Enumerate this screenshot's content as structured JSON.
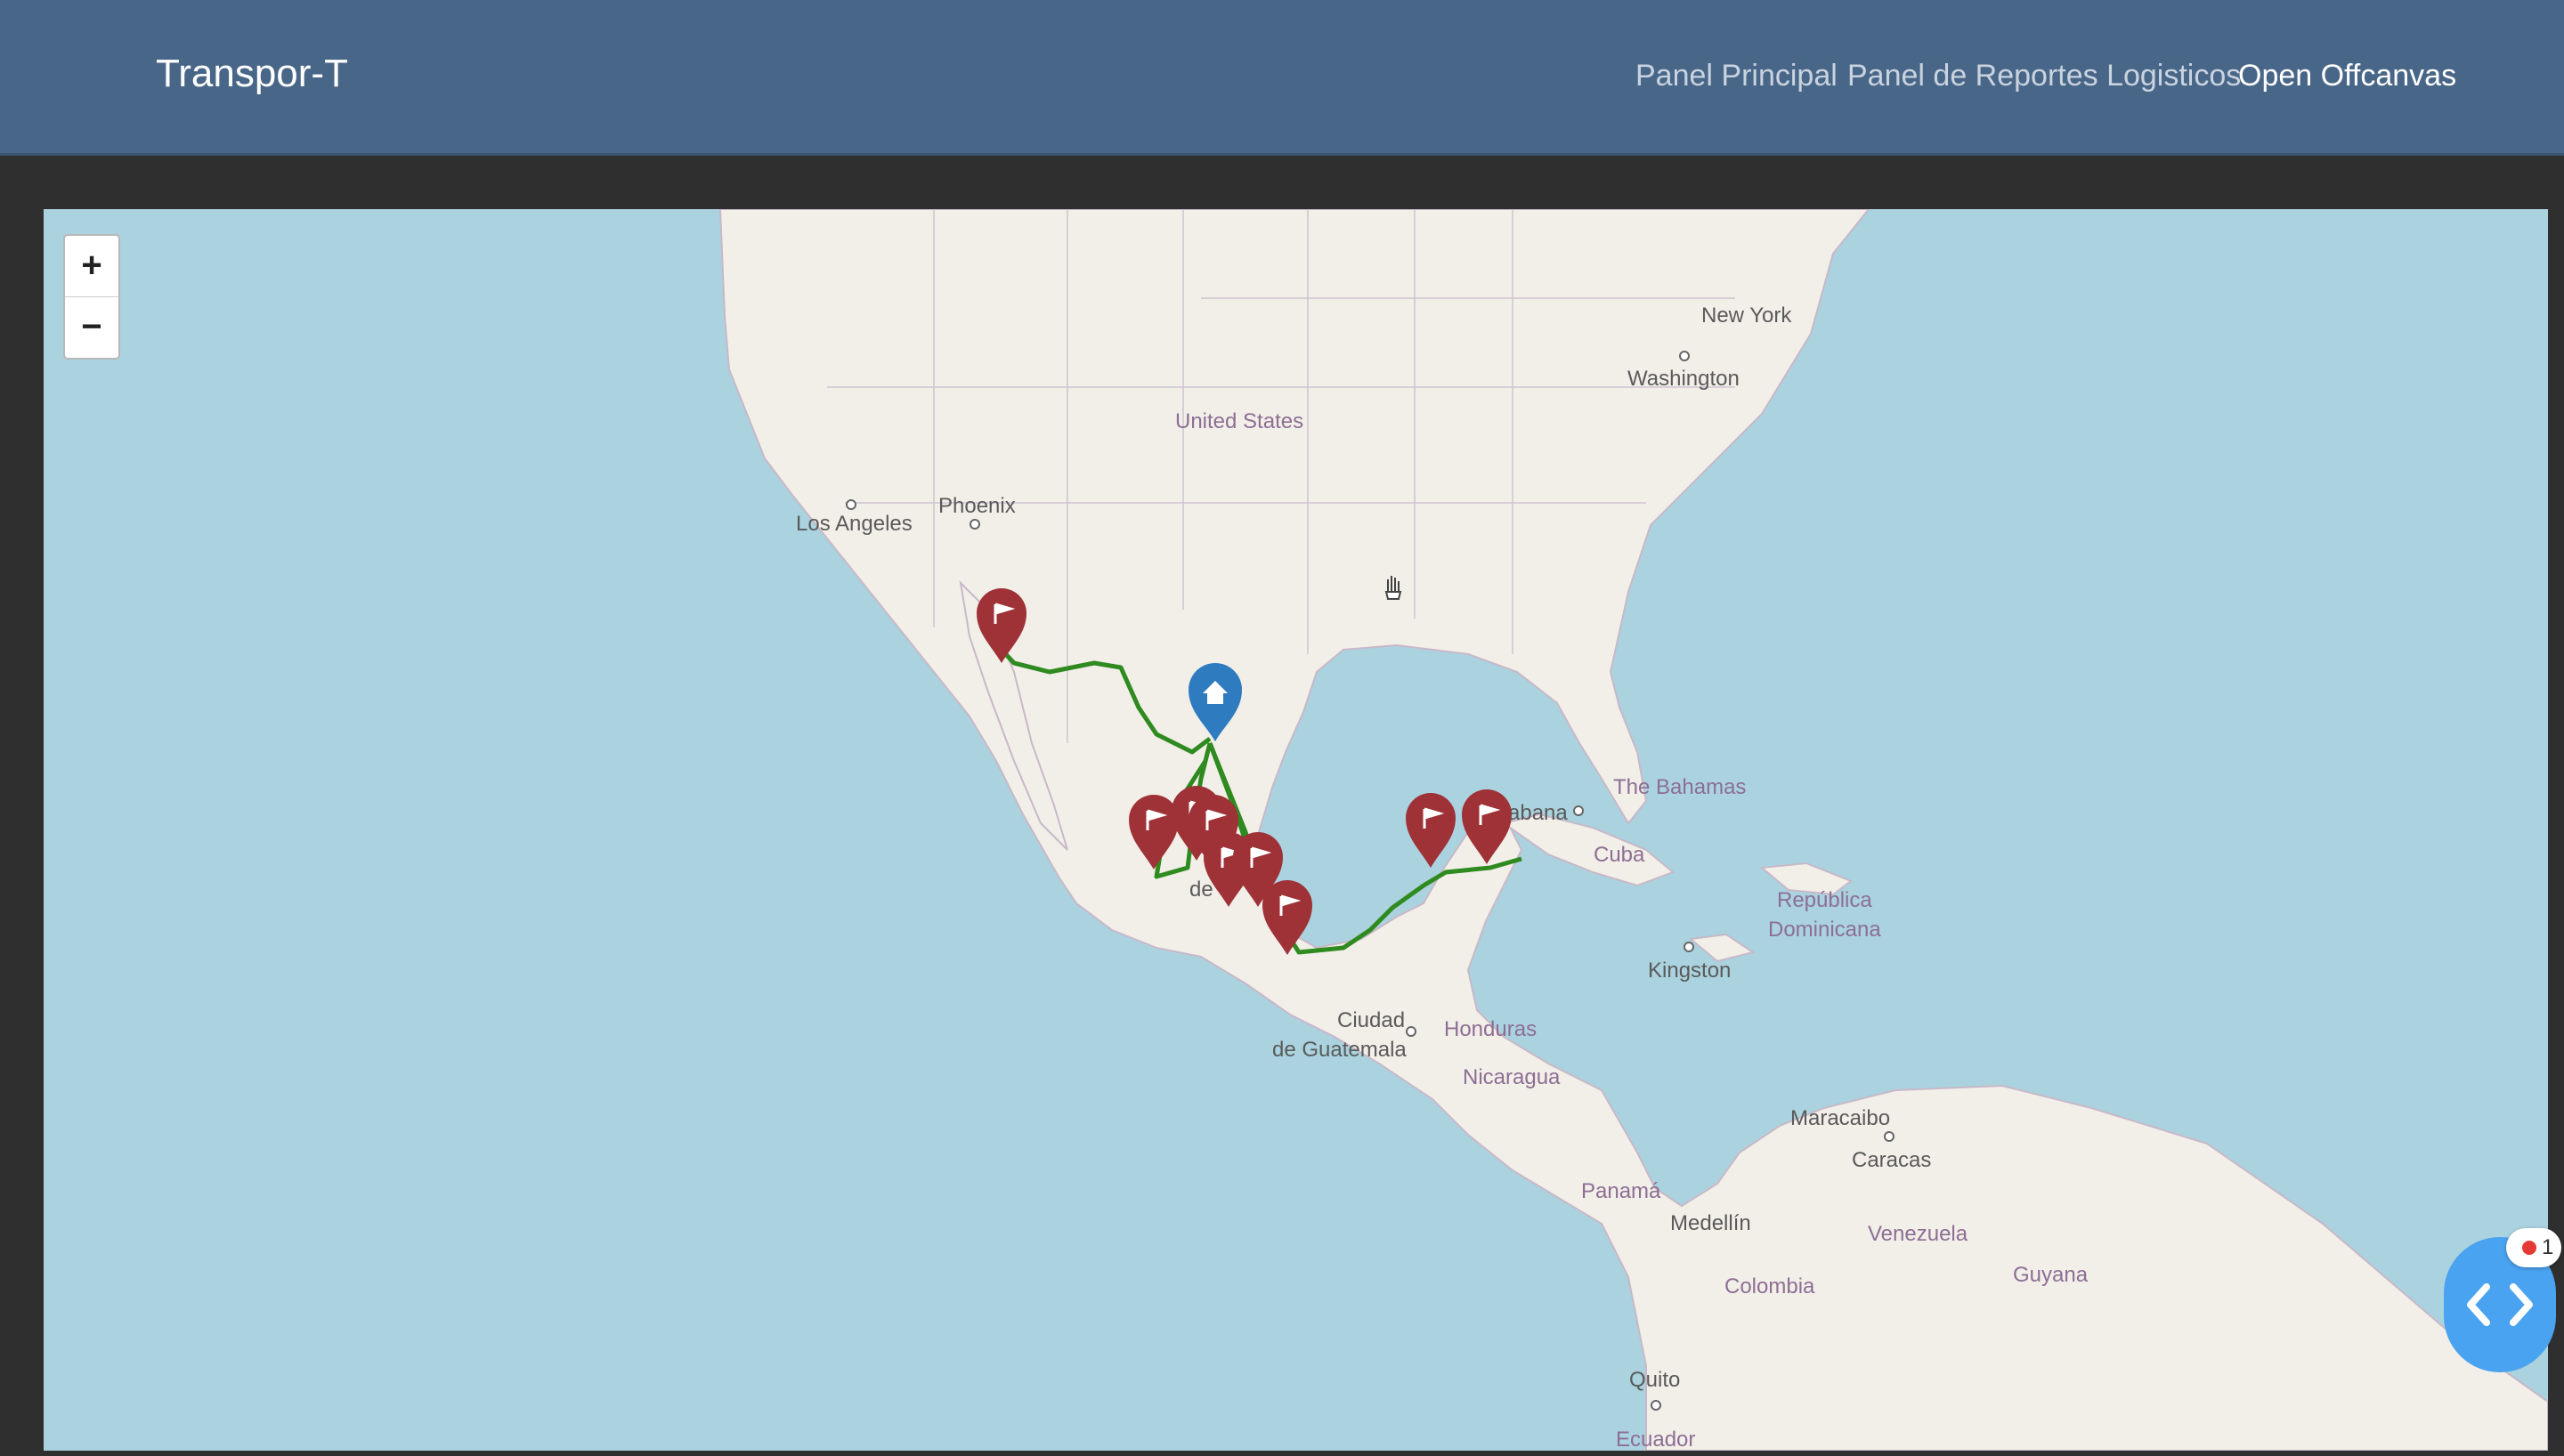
{
  "navbar": {
    "brand": "Transpor-T",
    "links": [
      "Panel Principal",
      "Panel de Reportes Logisticos",
      "Open Offcanvas"
    ]
  },
  "map": {
    "zoom_in": "+",
    "zoom_out": "−",
    "labels": {
      "new_york": "New York",
      "washington": "Washington",
      "united_states": "United States",
      "phoenix": "Phoenix",
      "los_angeles": "Los Angeles",
      "the_bahamas": "The Bahamas",
      "habana": "abana",
      "cuba": "Cuba",
      "republica": "República",
      "dominicana": "Dominicana",
      "kingston": "Kingston",
      "ciudad": "Ciudad",
      "de_guatemala": "de Guatemala",
      "honduras": "Honduras",
      "nicaragua": "Nicaragua",
      "maracaibo": "Maracaibo",
      "caracas": "Caracas",
      "panama": "Panamá",
      "medellin": "Medellín",
      "venezuela": "Venezuela",
      "guyana": "Guyana",
      "colombia": "Colombia",
      "quito": "Quito",
      "ecuador": "Ecuador",
      "mexico_fragment": "de"
    },
    "marker_colors": {
      "home": "#2f7bbf",
      "destination": "#9e3237",
      "route": "#2f8a1f"
    }
  },
  "widget": {
    "badge_count": "1"
  }
}
